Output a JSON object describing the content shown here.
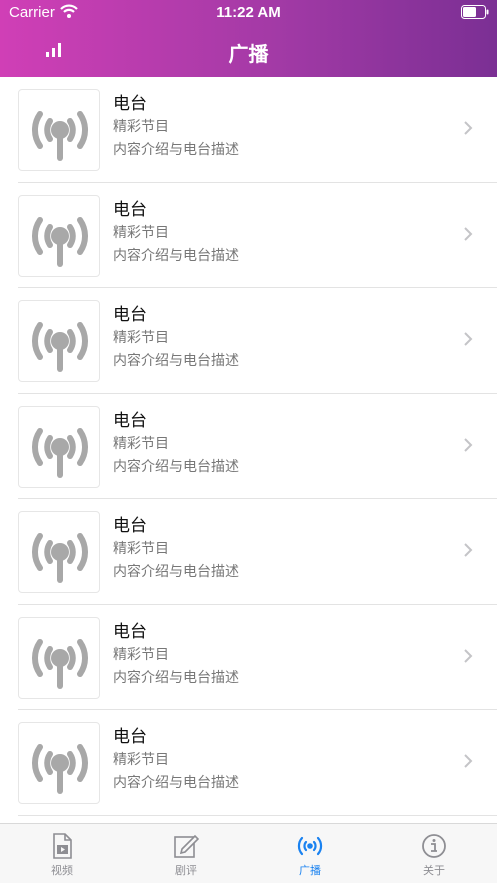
{
  "status_bar": {
    "carrier": "Carrier",
    "time": "11:22 AM"
  },
  "nav": {
    "title": "广播",
    "left_icon": "signal-bars-icon"
  },
  "colors": {
    "header_start": "#d03fb6",
    "header_end": "#7b2f94",
    "tab_active": "#1a82f0",
    "tab_inactive": "#8e8e93"
  },
  "stations": [
    {
      "title": "电台",
      "subtitle": "精彩节目",
      "description": "内容介绍与电台描述",
      "icon": "radio-antenna-icon"
    },
    {
      "title": "电台",
      "subtitle": "精彩节目",
      "description": "内容介绍与电台描述",
      "icon": "radio-antenna-icon"
    },
    {
      "title": "电台",
      "subtitle": "精彩节目",
      "description": "内容介绍与电台描述",
      "icon": "radio-antenna-icon"
    },
    {
      "title": "电台",
      "subtitle": "精彩节目",
      "description": "内容介绍与电台描述",
      "icon": "radio-antenna-icon"
    },
    {
      "title": "电台",
      "subtitle": "精彩节目",
      "description": "内容介绍与电台描述",
      "icon": "radio-antenna-icon"
    },
    {
      "title": "电台",
      "subtitle": "精彩节目",
      "description": "内容介绍与电台描述",
      "icon": "radio-antenna-icon"
    },
    {
      "title": "电台",
      "subtitle": "精彩节目",
      "description": "内容介绍与电台描述",
      "icon": "radio-antenna-icon"
    }
  ],
  "tabs": [
    {
      "label": "视频",
      "icon": "video-file-icon",
      "active": false
    },
    {
      "label": "剧评",
      "icon": "edit-icon",
      "active": false
    },
    {
      "label": "广播",
      "icon": "broadcast-icon",
      "active": true
    },
    {
      "label": "关于",
      "icon": "info-icon",
      "active": false
    }
  ]
}
